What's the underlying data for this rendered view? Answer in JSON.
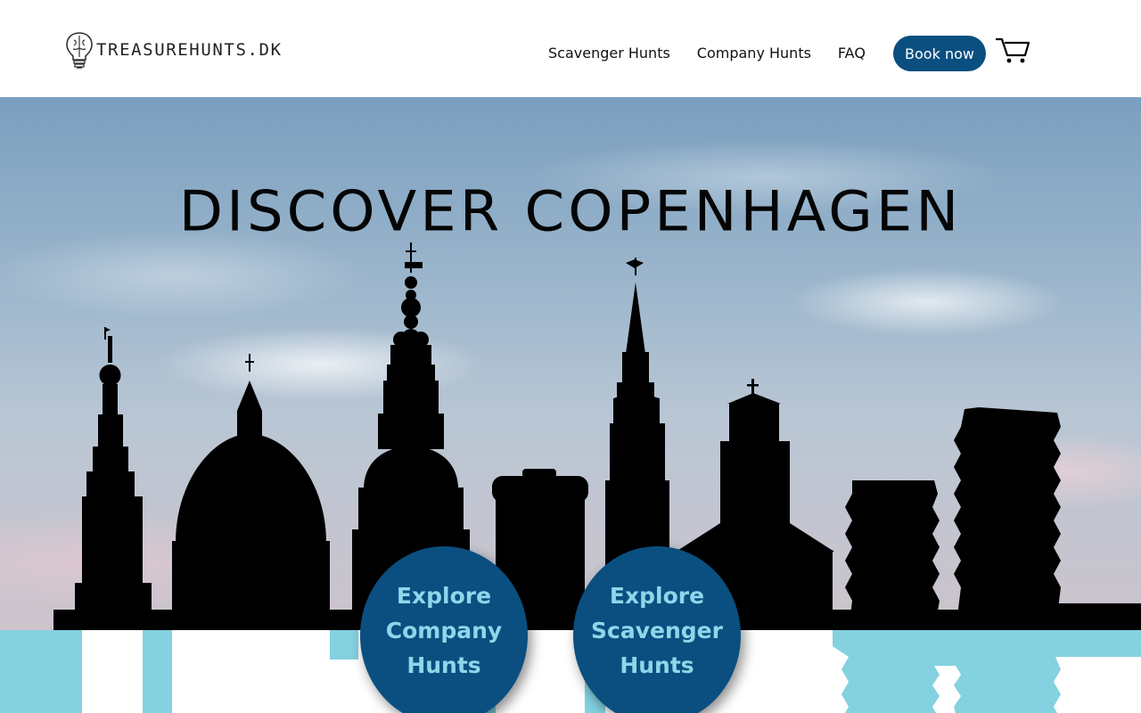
{
  "header": {
    "logo_text": "TREASUREHUNTS.DK",
    "logo_icon": "lightbulb-brain-icon",
    "nav": [
      {
        "label": "Scavenger Hunts"
      },
      {
        "label": "Company Hunts"
      },
      {
        "label": "FAQ"
      }
    ],
    "book_label": "Book now",
    "cart_icon": "cart-icon"
  },
  "hero": {
    "title": "DISCOVER COPENHAGEN",
    "skyline": "copenhagen-skyline-silhouette"
  },
  "cta": {
    "company": {
      "line1": "Explore",
      "line2": "Company",
      "line3": "Hunts"
    },
    "scavenger": {
      "line1": "Explore",
      "line2": "Scavenger",
      "line3": "Hunts"
    }
  },
  "colors": {
    "primary": "#0a4f80",
    "accent_text": "#8fd6ea",
    "reflection": "#84d1e0",
    "silhouette": "#000000"
  }
}
